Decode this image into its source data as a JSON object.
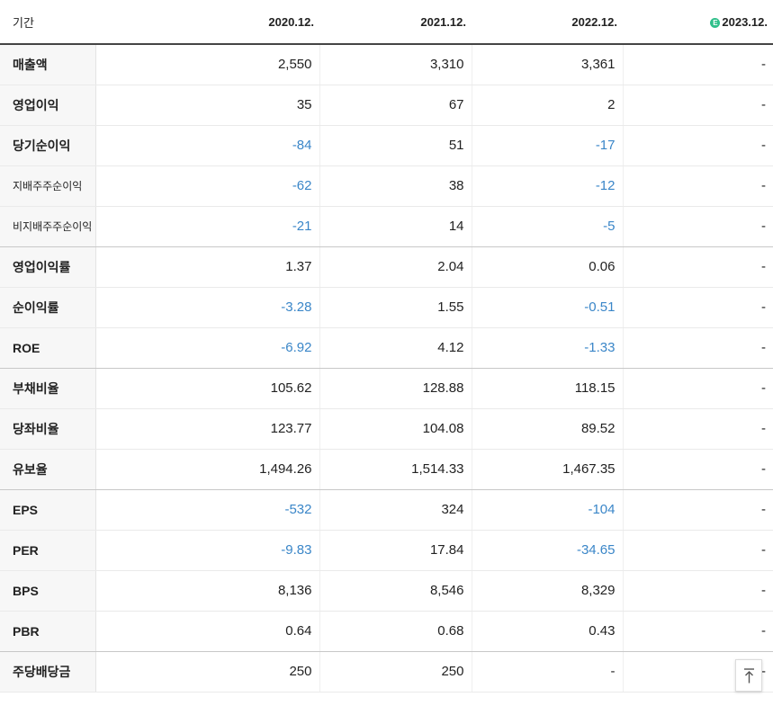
{
  "header": {
    "period_label": "기간",
    "columns": [
      "2020.12.",
      "2021.12.",
      "2022.12.",
      "2023.12."
    ],
    "estimate_badge": "E"
  },
  "rows": [
    {
      "label": "매출액",
      "values": [
        "2,550",
        "3,310",
        "3,361",
        "-"
      ],
      "negative": [
        false,
        false,
        false,
        false
      ]
    },
    {
      "label": "영업이익",
      "values": [
        "35",
        "67",
        "2",
        "-"
      ],
      "negative": [
        false,
        false,
        false,
        false
      ]
    },
    {
      "label": "당기순이익",
      "values": [
        "-84",
        "51",
        "-17",
        "-"
      ],
      "negative": [
        true,
        false,
        true,
        false
      ]
    },
    {
      "label": "지배주주순이익",
      "values": [
        "-62",
        "38",
        "-12",
        "-"
      ],
      "negative": [
        true,
        false,
        true,
        false
      ]
    },
    {
      "label": "비지배주주순이익",
      "values": [
        "-21",
        "14",
        "-5",
        "-"
      ],
      "negative": [
        true,
        false,
        true,
        false
      ]
    },
    {
      "label": "영업이익률",
      "values": [
        "1.37",
        "2.04",
        "0.06",
        "-"
      ],
      "negative": [
        false,
        false,
        false,
        false
      ]
    },
    {
      "label": "순이익률",
      "values": [
        "-3.28",
        "1.55",
        "-0.51",
        "-"
      ],
      "negative": [
        true,
        false,
        true,
        false
      ]
    },
    {
      "label": "ROE",
      "values": [
        "-6.92",
        "4.12",
        "-1.33",
        "-"
      ],
      "negative": [
        true,
        false,
        true,
        false
      ]
    },
    {
      "label": "부채비율",
      "values": [
        "105.62",
        "128.88",
        "118.15",
        "-"
      ],
      "negative": [
        false,
        false,
        false,
        false
      ]
    },
    {
      "label": "당좌비율",
      "values": [
        "123.77",
        "104.08",
        "89.52",
        "-"
      ],
      "negative": [
        false,
        false,
        false,
        false
      ]
    },
    {
      "label": "유보율",
      "values": [
        "1,494.26",
        "1,514.33",
        "1,467.35",
        "-"
      ],
      "negative": [
        false,
        false,
        false,
        false
      ]
    },
    {
      "label": "EPS",
      "values": [
        "-532",
        "324",
        "-104",
        "-"
      ],
      "negative": [
        true,
        false,
        true,
        false
      ]
    },
    {
      "label": "PER",
      "values": [
        "-9.83",
        "17.84",
        "-34.65",
        "-"
      ],
      "negative": [
        true,
        false,
        true,
        false
      ]
    },
    {
      "label": "BPS",
      "values": [
        "8,136",
        "8,546",
        "8,329",
        "-"
      ],
      "negative": [
        false,
        false,
        false,
        false
      ]
    },
    {
      "label": "PBR",
      "values": [
        "0.64",
        "0.68",
        "0.43",
        "-"
      ],
      "negative": [
        false,
        false,
        false,
        false
      ]
    },
    {
      "label": "주당배당금",
      "values": [
        "250",
        "250",
        "-",
        "-"
      ],
      "negative": [
        false,
        false,
        false,
        false
      ]
    }
  ],
  "colors": {
    "negative_value": "#3a86c8",
    "estimate_badge": "#2fbf8a"
  },
  "scroll_top_icon": "arrow-up-to-top-icon"
}
